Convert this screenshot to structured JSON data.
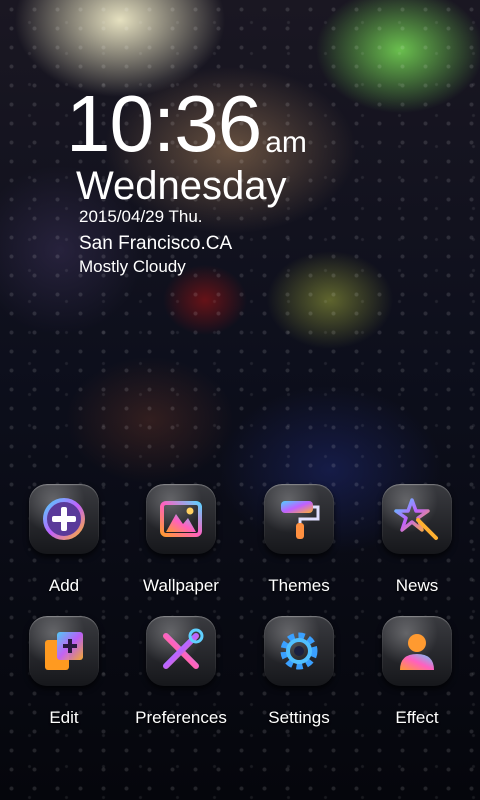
{
  "clock": {
    "time": "10:36",
    "ampm": "am",
    "day": "Wednesday",
    "date": "2015/04/29 Thu.",
    "city": "San Francisco.CA",
    "weather": "Mostly Cloudy"
  },
  "apps": [
    {
      "label": "Add",
      "icon": "add-icon"
    },
    {
      "label": "Wallpaper",
      "icon": "wallpaper-icon"
    },
    {
      "label": "Themes",
      "icon": "paint-roller-icon"
    },
    {
      "label": "News",
      "icon": "star-wand-icon"
    },
    {
      "label": "Edit",
      "icon": "edit-icon"
    },
    {
      "label": "Preferences",
      "icon": "tools-icon"
    },
    {
      "label": "Settings",
      "icon": "gear-icon"
    },
    {
      "label": "Effect",
      "icon": "person-icon"
    }
  ],
  "colors": {
    "icon_gradient_start": "#4fd0ff",
    "icon_gradient_mid": "#c060ff",
    "icon_gradient_end": "#ffb030"
  }
}
